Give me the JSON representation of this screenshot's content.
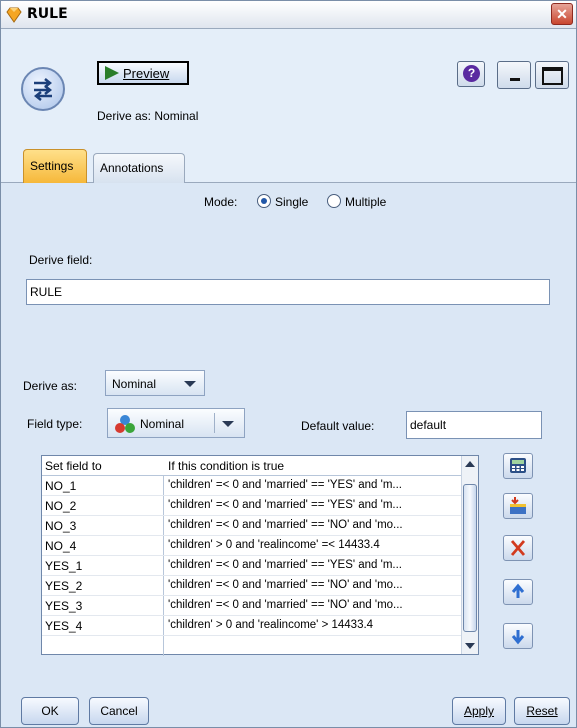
{
  "window": {
    "title": "RULE",
    "close_label": "✕"
  },
  "header": {
    "preview_label": "Preview",
    "help_label": "?",
    "subtitle": "Derive as: Nominal"
  },
  "tabs": [
    {
      "label": "Settings",
      "active": true
    },
    {
      "label": "Annotations",
      "active": false
    }
  ],
  "settings": {
    "mode_label": "Mode:",
    "mode_options": [
      "Single",
      "Multiple"
    ],
    "mode_selected": "Single",
    "derive_field_label": "Derive field:",
    "derive_field_value": "RULE",
    "derive_as_label": "Derive as:",
    "derive_as_value": "Nominal",
    "field_type_label": "Field type:",
    "field_type_value": "Nominal",
    "default_value_label": "Default value:",
    "default_value": "default"
  },
  "table": {
    "columns": [
      "Set field to",
      "If this condition is true"
    ],
    "rows": [
      {
        "set_field": "NO_1",
        "condition": "'children' =< 0 and 'married' == 'YES' and 'm..."
      },
      {
        "set_field": "NO_2",
        "condition": "'children' =< 0 and 'married' == 'YES' and 'm..."
      },
      {
        "set_field": "NO_3",
        "condition": "'children' =< 0 and 'married' == 'NO' and 'mo..."
      },
      {
        "set_field": "NO_4",
        "condition": "'children' > 0 and 'realincome' =< 14433.4"
      },
      {
        "set_field": "YES_1",
        "condition": "'children' =< 0 and 'married' == 'YES' and 'm..."
      },
      {
        "set_field": "YES_2",
        "condition": "'children' =< 0 and 'married' == 'NO' and 'mo..."
      },
      {
        "set_field": "YES_3",
        "condition": "'children' =< 0 and 'married' == 'NO' and 'mo..."
      },
      {
        "set_field": "YES_4",
        "condition": "'children' > 0 and 'realincome' > 14433.4"
      }
    ]
  },
  "side_buttons": [
    "expression-builder-icon",
    "insert-row-icon",
    "delete-icon",
    "move-up-icon",
    "move-down-icon"
  ],
  "footer": {
    "ok_label": "OK",
    "cancel_label": "Cancel",
    "apply_label": "Apply",
    "reset_label": "Reset"
  },
  "colors": {
    "panel_bg": "#dbe7f5",
    "active_tab": "#f6b83a",
    "delete": "#d23a1e",
    "arrow": "#2f6fd1"
  }
}
